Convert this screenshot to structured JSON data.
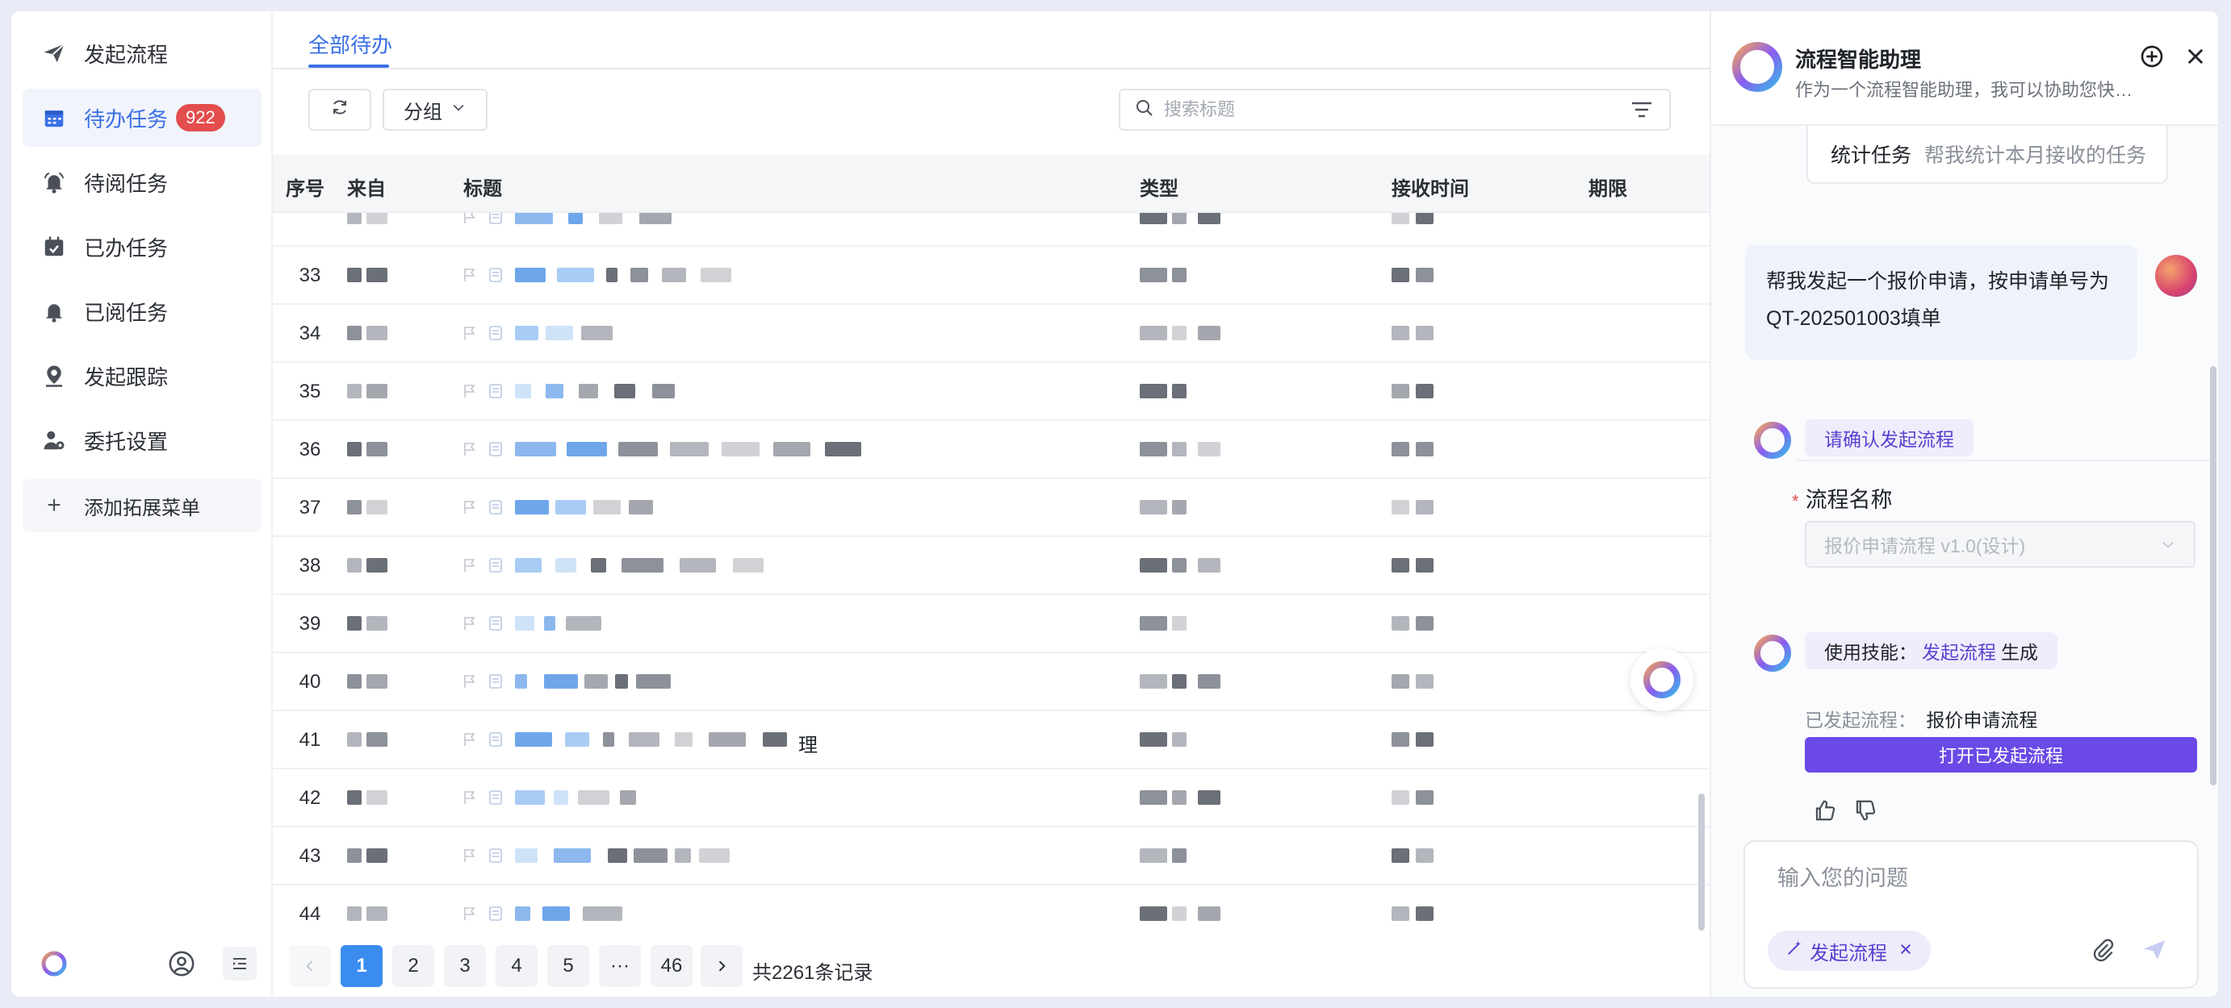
{
  "sidebar": {
    "items": [
      {
        "label": "发起流程",
        "icon": "send-icon"
      },
      {
        "label": "待办任务",
        "icon": "calendar-icon",
        "badge": "922",
        "active": true
      },
      {
        "label": "待阅任务",
        "icon": "bell-ring-icon"
      },
      {
        "label": "已办任务",
        "icon": "calendar-check-icon"
      },
      {
        "label": "已阅任务",
        "icon": "bell-icon"
      },
      {
        "label": "发起跟踪",
        "icon": "location-pin-icon"
      },
      {
        "label": "委托设置",
        "icon": "user-gear-icon"
      }
    ],
    "add_menu": "添加拓展菜单"
  },
  "main": {
    "tab": "全部待办",
    "group_label": "分组",
    "search_placeholder": "搜索标题",
    "columns": [
      "序号",
      "来自",
      "标题",
      "类型",
      "接收时间",
      "期限"
    ],
    "rows": [
      {
        "num": ""
      },
      {
        "num": "33"
      },
      {
        "num": "34"
      },
      {
        "num": "35"
      },
      {
        "num": "36"
      },
      {
        "num": "37"
      },
      {
        "num": "38"
      },
      {
        "num": "39"
      },
      {
        "num": "40"
      },
      {
        "num": "41",
        "title_tail": "理"
      },
      {
        "num": "42"
      },
      {
        "num": "43"
      },
      {
        "num": "44"
      }
    ],
    "pagination": {
      "pages": [
        "1",
        "2",
        "3",
        "4",
        "5",
        "···",
        "46"
      ],
      "current": "1",
      "total": "共2261条记录"
    }
  },
  "assistant": {
    "title": "流程智能助理",
    "subtitle": "作为一个流程智能助理，我可以协助您快捷发起流程...",
    "stat_chip": {
      "label": "统计任务",
      "desc": "帮我统计本月接收的任务"
    },
    "user_message_line1": "帮我发起一个报价申请，按申请单号为",
    "user_message_line2": "QT-202501003填单",
    "confirm_tag": "请确认发起流程",
    "field_label": "流程名称",
    "field_value": "报价申请流程 v1.0(设计)",
    "skill_prefix": "使用技能：",
    "skill_name": "发起流程",
    "skill_suffix": "生成",
    "sent_label": "已发起流程：",
    "sent_value": "报价申请流程",
    "open_button": "打开已发起流程",
    "input_placeholder": "输入您的问题",
    "skill_chip": "发起流程",
    "colors": {
      "accent": "#6b49e6",
      "primary": "#3a70e6",
      "badge": "#e34d4d"
    }
  }
}
